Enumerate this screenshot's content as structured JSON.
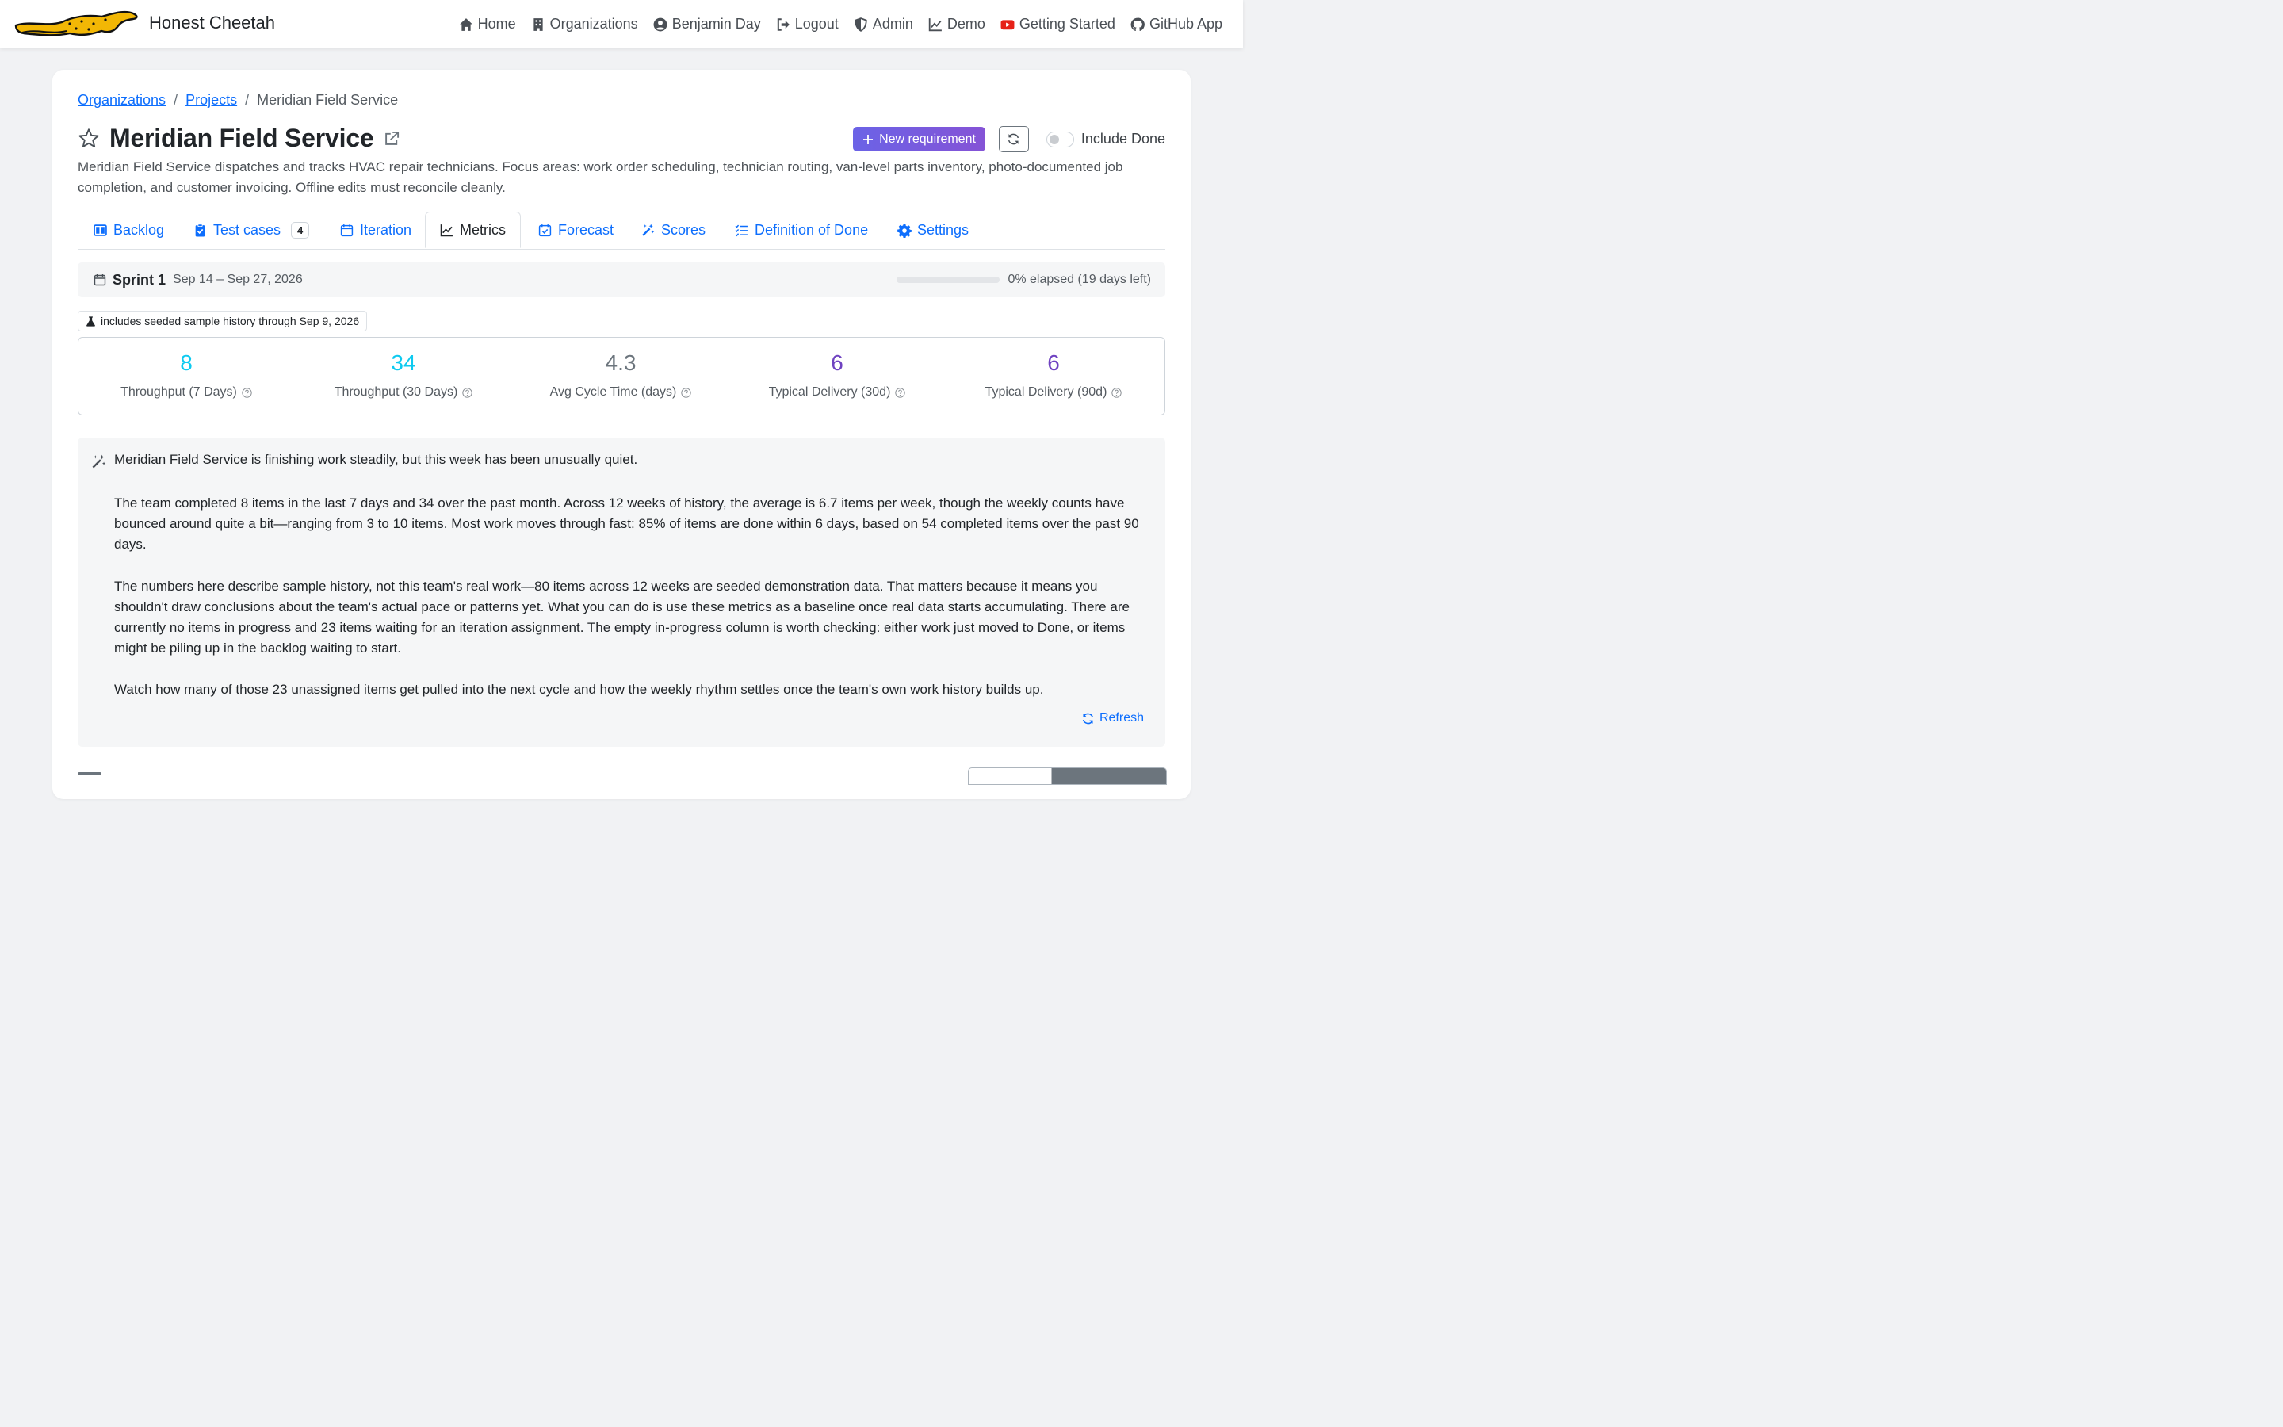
{
  "app": {
    "name": "Honest Cheetah"
  },
  "nav": {
    "items": [
      {
        "label": "Home",
        "icon": "home-icon"
      },
      {
        "label": "Organizations",
        "icon": "building-icon"
      },
      {
        "label": "Benjamin Day",
        "icon": "user-circle-icon"
      },
      {
        "label": "Logout",
        "icon": "logout-icon"
      },
      {
        "label": "Admin",
        "icon": "shield-icon"
      },
      {
        "label": "Demo",
        "icon": "graph-icon"
      },
      {
        "label": "Getting Started",
        "icon": "youtube-icon"
      },
      {
        "label": "GitHub App",
        "icon": "github-icon"
      }
    ]
  },
  "breadcrumb": {
    "organizations": "Organizations",
    "projects": "Projects",
    "separator": "/",
    "current": "Meridian Field Service"
  },
  "project": {
    "title": "Meridian Field Service",
    "description": "Meridian Field Service dispatches and tracks HVAC repair technicians. Focus areas: work order scheduling, technician routing, van-level parts inventory, photo-documented job completion, and customer invoicing. Offline edits must reconcile cleanly."
  },
  "actions": {
    "new_requirement": "New requirement",
    "include_done": "Include Done",
    "include_done_checked": false
  },
  "tabs": [
    {
      "label": "Backlog",
      "icon": "layout-columns-icon"
    },
    {
      "label": "Test cases",
      "icon": "clipboard-check-icon",
      "badge": "4"
    },
    {
      "label": "Iteration",
      "icon": "calendar-icon"
    },
    {
      "label": "Metrics",
      "icon": "graph-up-icon",
      "active": true
    },
    {
      "label": "Forecast",
      "icon": "calendar-check-icon"
    },
    {
      "label": "Scores",
      "icon": "magic-wand-icon"
    },
    {
      "label": "Definition of Done",
      "icon": "checklist-icon"
    },
    {
      "label": "Settings",
      "icon": "gear-icon"
    }
  ],
  "sprint": {
    "name": "Sprint 1",
    "dates": "Sep 14 – Sep 27, 2026",
    "elapsed_fraction": 0.0,
    "elapsed_text": "0% elapsed (19 days left)"
  },
  "sample_badge": "includes seeded sample history through Sep 9, 2026",
  "stats": [
    {
      "value": "8",
      "label": "Throughput (7 Days)",
      "color": "#0dcaf0"
    },
    {
      "value": "34",
      "label": "Throughput (30 Days)",
      "color": "#0dcaf0"
    },
    {
      "value": "4.3",
      "label": "Avg Cycle Time (days)",
      "color": "#6c757d"
    },
    {
      "value": "6",
      "label": "Typical Delivery (30d)",
      "color": "#6f42c1"
    },
    {
      "value": "6",
      "label": "Typical Delivery (90d)",
      "color": "#6f42c1"
    }
  ],
  "summary": {
    "lead": "Meridian Field Service is finishing work steadily, but this week has been unusually quiet.",
    "paragraphs": [
      "The team completed 8 items in the last 7 days and 34 over the past month. Across 12 weeks of history, the average is 6.7 items per week, though the weekly counts have bounced around quite a bit—ranging from 3 to 10 items. Most work moves through fast: 85% of items are done within 6 days, based on 54 completed items over the past 90 days.",
      "The numbers here describe sample history, not this team's real work—80 items across 12 weeks are seeded demonstration data. That matters because it means you shouldn't draw conclusions about the team's actual pace or patterns yet. What you can do is use these metrics as a baseline once real data starts accumulating. There are currently no items in progress and 23 items waiting for an iteration assignment. The empty in-progress column is worth checking: either work just moved to Done, or items might be piling up in the backlog waiting to start.",
      "Watch how many of those 23 unassigned items get pulled into the next cycle and how the weekly rhythm settles once the team's own work history builds up."
    ],
    "refresh": "Refresh"
  },
  "colors": {
    "primary": "#0d6efd",
    "accent_purple": "#6f42c1",
    "accent_cyan": "#0dcaf0",
    "brand_yellow": "#f2b705"
  }
}
